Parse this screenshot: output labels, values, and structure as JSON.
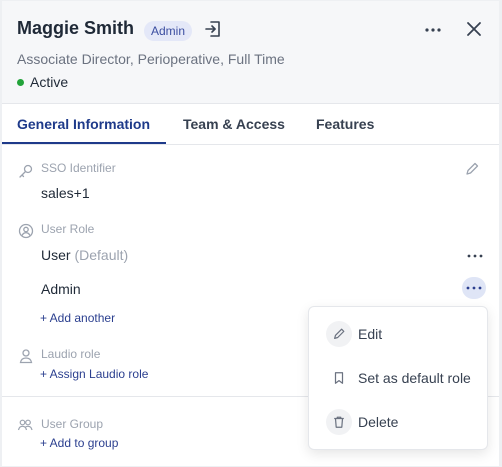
{
  "header": {
    "name": "Maggie Smith",
    "badge": "Admin",
    "subtitle": "Associate Director, Perioperative, Full Time",
    "status": "Active",
    "status_color": "#22a33a"
  },
  "tabs": [
    {
      "label": "General Information",
      "active": true
    },
    {
      "label": "Team & Access",
      "active": false
    },
    {
      "label": "Features",
      "active": false
    }
  ],
  "sso": {
    "label": "SSO Identifier",
    "value": "sales+1"
  },
  "user_role": {
    "label": "User Role",
    "roles": [
      {
        "name": "User",
        "suffix": "(Default)"
      },
      {
        "name": "Admin",
        "suffix": ""
      }
    ],
    "add_link": "+ Add another"
  },
  "laudio_role": {
    "label": "Laudio role",
    "link": "+ Assign Laudio role"
  },
  "user_group": {
    "label": "User Group",
    "link": "+ Add to group"
  },
  "context_menu": {
    "items": [
      {
        "label": "Edit",
        "icon": "pencil-icon"
      },
      {
        "label": "Set as default role",
        "icon": "bookmark-icon"
      },
      {
        "label": "Delete",
        "icon": "trash-icon"
      }
    ]
  },
  "colors": {
    "accent": "#1e3a8a",
    "link": "#2b3f8f",
    "badge_bg": "#e4e8f8"
  }
}
